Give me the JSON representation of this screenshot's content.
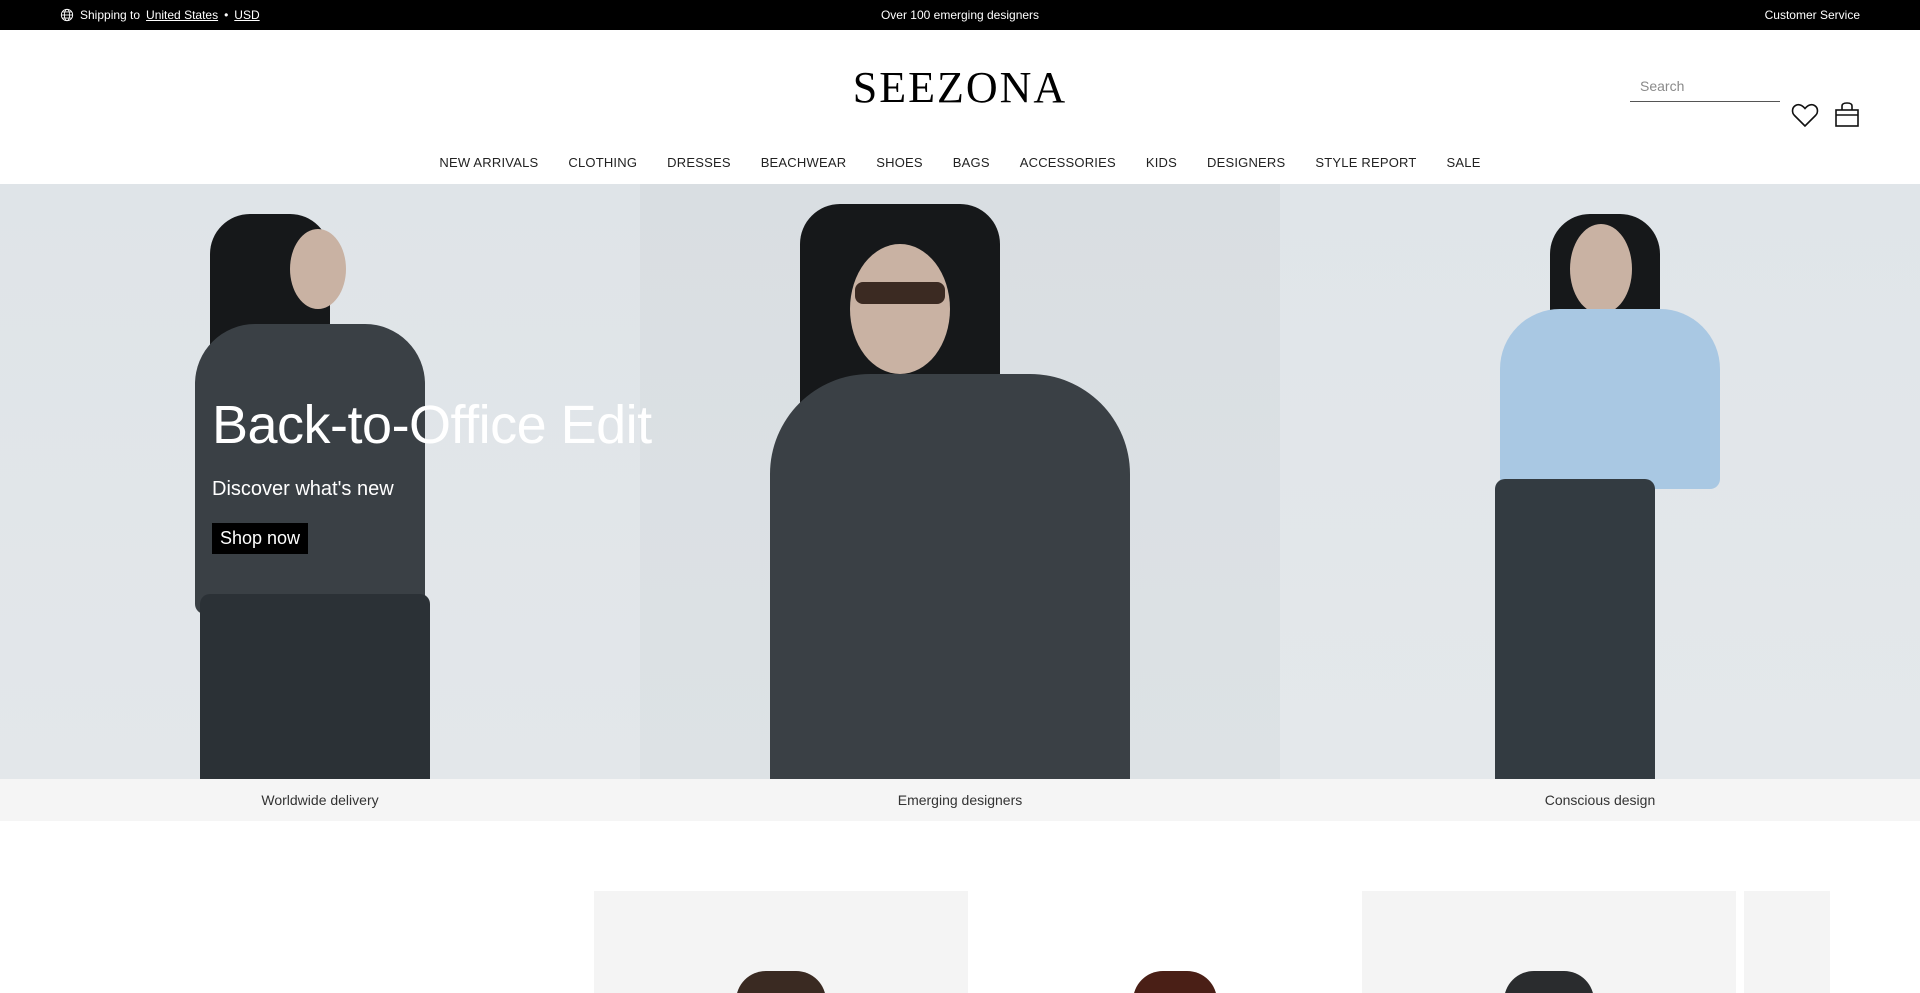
{
  "topbar": {
    "shipping_prefix": "Shipping to",
    "country": "United States",
    "currency": "USD",
    "separator": "•",
    "announcement": "Over 100 emerging designers",
    "customer_service": "Customer Service"
  },
  "header": {
    "logo": "SEEZONA",
    "search_placeholder": "Search",
    "icons": [
      "heart-icon",
      "bag-icon",
      "globe-icon"
    ]
  },
  "nav": {
    "items": [
      "NEW ARRIVALS",
      "CLOTHING",
      "DRESSES",
      "BEACHWEAR",
      "SHOES",
      "BAGS",
      "ACCESSORIES",
      "KIDS",
      "DESIGNERS",
      "STYLE REPORT",
      "SALE"
    ]
  },
  "hero": {
    "title": "Back-to-Office Edit",
    "subtitle": "Discover what's new",
    "cta": "Shop now"
  },
  "benefits": [
    "Worldwide delivery",
    "Emerging designers",
    "Conscious design"
  ],
  "colors": {
    "topbar_bg": "#000000",
    "text": "#111111",
    "benefits_bg": "#f5f5f5"
  }
}
